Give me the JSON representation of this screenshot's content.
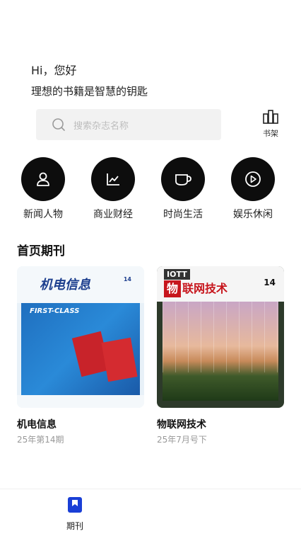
{
  "header": {
    "greeting": "Hi，您好",
    "motto": "理想的书籍是智慧的钥匙"
  },
  "search": {
    "placeholder": "搜索杂志名称",
    "icon": "search-icon"
  },
  "bookshelf": {
    "label": "书架",
    "icon": "bookshelf-icon"
  },
  "categories": [
    {
      "label": "新闻人物",
      "icon": "person-icon"
    },
    {
      "label": "商业财经",
      "icon": "line-chart-icon"
    },
    {
      "label": "时尚生活",
      "icon": "cup-icon"
    },
    {
      "label": "娱乐休闲",
      "icon": "play-icon"
    }
  ],
  "section": {
    "title": "首页期刊"
  },
  "magazines": [
    {
      "title": "机电信息",
      "issue": "25年第14期",
      "cover": {
        "masthead": "机电信息",
        "issue_no": "14",
        "banner": "FIRST-CLASS"
      }
    },
    {
      "title": "物联网技术",
      "issue": "25年7月号下",
      "cover": {
        "logo": "IOTT",
        "masthead": "联网技术",
        "masthead_first": "物",
        "issue_no": "14"
      }
    }
  ],
  "tabbar": {
    "items": [
      {
        "label": "期刊",
        "icon": "bookmark-icon",
        "active": true
      }
    ]
  },
  "colors": {
    "primary": "#0d0d0d",
    "accent": "#1a3fd6",
    "muted": "#999999"
  }
}
